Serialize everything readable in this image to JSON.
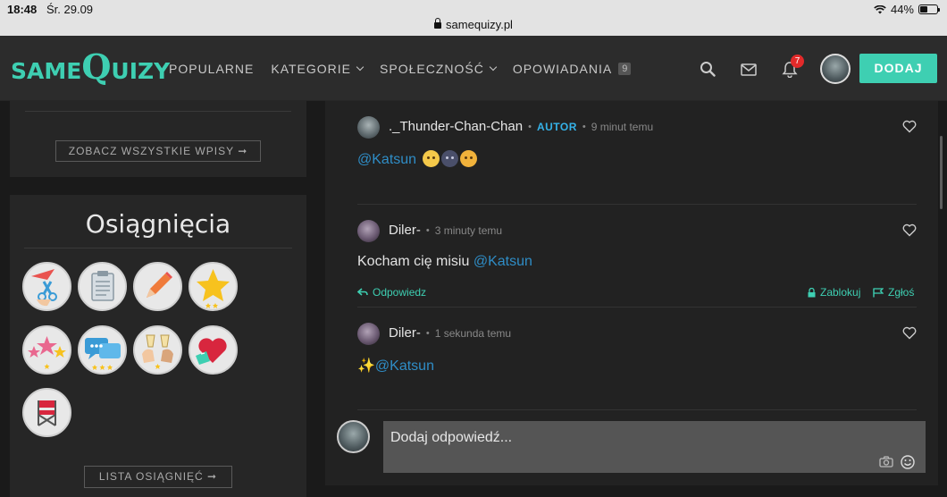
{
  "status_bar": {
    "time": "18:48",
    "date": "Śr. 29.09",
    "url": "samequizy.pl",
    "battery": "44%",
    "battery_level": 0.44
  },
  "navbar": {
    "logo_same": "SAME",
    "logo_q": "Q",
    "logo_uizy": "UIZY",
    "items": [
      {
        "label": "POPULARNE"
      },
      {
        "label": "KATEGORIE"
      },
      {
        "label": "SPOŁECZNOŚĆ"
      },
      {
        "label": "OPOWIADANIA",
        "count": "9"
      }
    ],
    "notification_count": "7",
    "add_label": "DODAJ",
    "accent": "#3ecfb2"
  },
  "sidebar": {
    "see_all_label": "ZOBACZ WSZYSTKIE WPISY ➞",
    "achievements_title": "Osiągnięcia",
    "achievement_icons": [
      "scissors-icon",
      "clipboard-icon",
      "pencil-icon",
      "star-icon",
      "stars-icon",
      "chat-bubbles-icon",
      "champagne-toast-icon",
      "heart-gift-icon",
      "directors-chair-icon"
    ],
    "list_label": "LISTA OSIĄGNIĘĆ ➞"
  },
  "comments": [
    {
      "user": "._Thunder-Chan-Chan",
      "role": "AUTOR",
      "time": "9 minut temu",
      "mention": "@Katsun"
    },
    {
      "user": "Diler-",
      "time": "3 minuty temu",
      "text": "Kocham cię misiu",
      "mention": "@Katsun",
      "reply_label": "Odpowiedz",
      "block_label": "Zablokuj",
      "report_label": "Zgłoś"
    },
    {
      "user": "Diler-",
      "time": "1 sekunda temu",
      "sparkle": "✨",
      "mention": "@Katsun"
    }
  ],
  "reply": {
    "placeholder": "Dodaj odpowiedź..."
  }
}
